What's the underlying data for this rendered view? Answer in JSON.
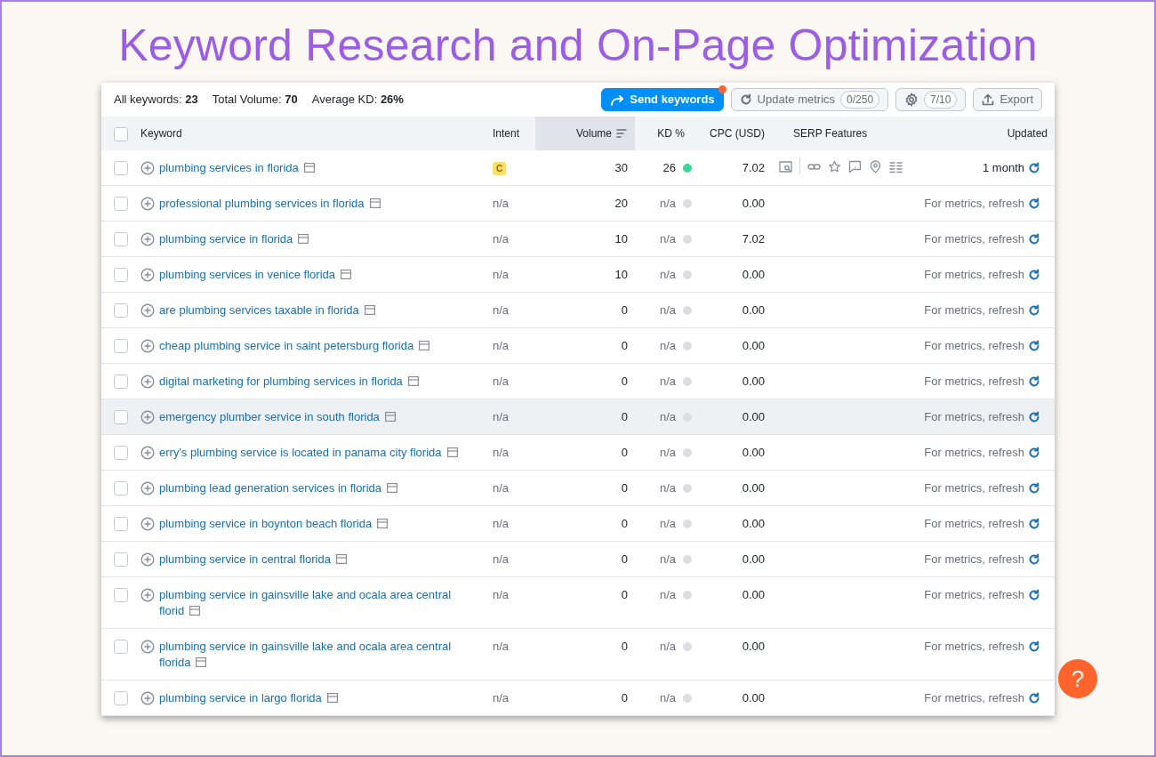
{
  "page_title": "Keyword Research and On-Page Optimization",
  "summary": [
    {
      "label": "All keywords:",
      "value": "23"
    },
    {
      "label": "Total Volume:",
      "value": "70"
    },
    {
      "label": "Average KD:",
      "value": "26%"
    }
  ],
  "toolbar": {
    "send": {
      "label": "Send keywords",
      "notification": true
    },
    "update": {
      "label": "Update metrics",
      "counter": "0/250"
    },
    "settings": {
      "counter": "7/10"
    },
    "export": {
      "label": "Export"
    }
  },
  "select_all": {
    "checked": false
  },
  "columns": [
    {
      "label": "Keyword",
      "sorted": false
    },
    {
      "label": "Intent",
      "sorted": false
    },
    {
      "label": "Volume",
      "sorted": true
    },
    {
      "label": "KD %",
      "sorted": false
    },
    {
      "label": "CPC (USD)",
      "sorted": false
    },
    {
      "label": "SERP Features",
      "sorted": false
    },
    {
      "label": "Updated",
      "sorted": false
    }
  ],
  "rows": [
    {
      "keyword": "plumbing services in florida",
      "intent": {
        "text": "C",
        "kind": "badge"
      },
      "volume": "30",
      "kd": {
        "text": "26",
        "color": "#3dd598"
      },
      "cpc": "7.02",
      "serp_features": true,
      "updated": "1 month",
      "checked": false,
      "hovered": false
    },
    {
      "keyword": "professional plumbing services in florida",
      "intent": {
        "text": "n/a",
        "kind": "text"
      },
      "volume": "20",
      "kd": {
        "text": "n/a",
        "color": "#dcdee3"
      },
      "cpc": "0.00",
      "serp_features": false,
      "updated": "For metrics, refresh",
      "checked": false,
      "hovered": false
    },
    {
      "keyword": "plumbing service in florida",
      "intent": {
        "text": "n/a",
        "kind": "text"
      },
      "volume": "10",
      "kd": {
        "text": "n/a",
        "color": "#dcdee3"
      },
      "cpc": "7.02",
      "serp_features": false,
      "updated": "For metrics, refresh",
      "checked": false,
      "hovered": false
    },
    {
      "keyword": "plumbing services in venice florida",
      "intent": {
        "text": "n/a",
        "kind": "text"
      },
      "volume": "10",
      "kd": {
        "text": "n/a",
        "color": "#dcdee3"
      },
      "cpc": "0.00",
      "serp_features": false,
      "updated": "For metrics, refresh",
      "checked": false,
      "hovered": false
    },
    {
      "keyword": "are plumbing services taxable in florida",
      "intent": {
        "text": "n/a",
        "kind": "text"
      },
      "volume": "0",
      "kd": {
        "text": "n/a",
        "color": "#dcdee3"
      },
      "cpc": "0.00",
      "serp_features": false,
      "updated": "For metrics, refresh",
      "checked": false,
      "hovered": false
    },
    {
      "keyword": "cheap plumbing service in saint petersburg florida",
      "intent": {
        "text": "n/a",
        "kind": "text"
      },
      "volume": "0",
      "kd": {
        "text": "n/a",
        "color": "#dcdee3"
      },
      "cpc": "0.00",
      "serp_features": false,
      "updated": "For metrics, refresh",
      "checked": false,
      "hovered": false
    },
    {
      "keyword": "digital marketing for plumbing services in florida",
      "intent": {
        "text": "n/a",
        "kind": "text"
      },
      "volume": "0",
      "kd": {
        "text": "n/a",
        "color": "#dcdee3"
      },
      "cpc": "0.00",
      "serp_features": false,
      "updated": "For metrics, refresh",
      "checked": false,
      "hovered": false
    },
    {
      "keyword": "emergency plumber service in south florida",
      "intent": {
        "text": "n/a",
        "kind": "text"
      },
      "volume": "0",
      "kd": {
        "text": "n/a",
        "color": "#dcdee3"
      },
      "cpc": "0.00",
      "serp_features": false,
      "updated": "For metrics, refresh",
      "checked": false,
      "hovered": true
    },
    {
      "keyword": "erry's plumbing service is located in panama city florida",
      "intent": {
        "text": "n/a",
        "kind": "text"
      },
      "volume": "0",
      "kd": {
        "text": "n/a",
        "color": "#dcdee3"
      },
      "cpc": "0.00",
      "serp_features": false,
      "updated": "For metrics, refresh",
      "checked": false,
      "hovered": false
    },
    {
      "keyword": "plumbing lead generation services in florida",
      "intent": {
        "text": "n/a",
        "kind": "text"
      },
      "volume": "0",
      "kd": {
        "text": "n/a",
        "color": "#dcdee3"
      },
      "cpc": "0.00",
      "serp_features": false,
      "updated": "For metrics, refresh",
      "checked": false,
      "hovered": false
    },
    {
      "keyword": "plumbing service in boynton beach florida",
      "intent": {
        "text": "n/a",
        "kind": "text"
      },
      "volume": "0",
      "kd": {
        "text": "n/a",
        "color": "#dcdee3"
      },
      "cpc": "0.00",
      "serp_features": false,
      "updated": "For metrics, refresh",
      "checked": false,
      "hovered": false
    },
    {
      "keyword": "plumbing service in central florida",
      "intent": {
        "text": "n/a",
        "kind": "text"
      },
      "volume": "0",
      "kd": {
        "text": "n/a",
        "color": "#dcdee3"
      },
      "cpc": "0.00",
      "serp_features": false,
      "updated": "For metrics, refresh",
      "checked": false,
      "hovered": false
    },
    {
      "keyword": "plumbing service in gainsville lake and ocala area central florid",
      "intent": {
        "text": "n/a",
        "kind": "text"
      },
      "volume": "0",
      "kd": {
        "text": "n/a",
        "color": "#dcdee3"
      },
      "cpc": "0.00",
      "serp_features": false,
      "updated": "For metrics, refresh",
      "checked": false,
      "hovered": false
    },
    {
      "keyword": "plumbing service in gainsville lake and ocala area central florida",
      "intent": {
        "text": "n/a",
        "kind": "text"
      },
      "volume": "0",
      "kd": {
        "text": "n/a",
        "color": "#dcdee3"
      },
      "cpc": "0.00",
      "serp_features": false,
      "updated": "For metrics, refresh",
      "checked": false,
      "hovered": false
    },
    {
      "keyword": "plumbing service in largo florida",
      "intent": {
        "text": "n/a",
        "kind": "text"
      },
      "volume": "0",
      "kd": {
        "text": "n/a",
        "color": "#dcdee3"
      },
      "cpc": "0.00",
      "serp_features": false,
      "updated": "For metrics, refresh",
      "checked": false,
      "hovered": false
    }
  ],
  "help_button": {
    "label": "?"
  }
}
